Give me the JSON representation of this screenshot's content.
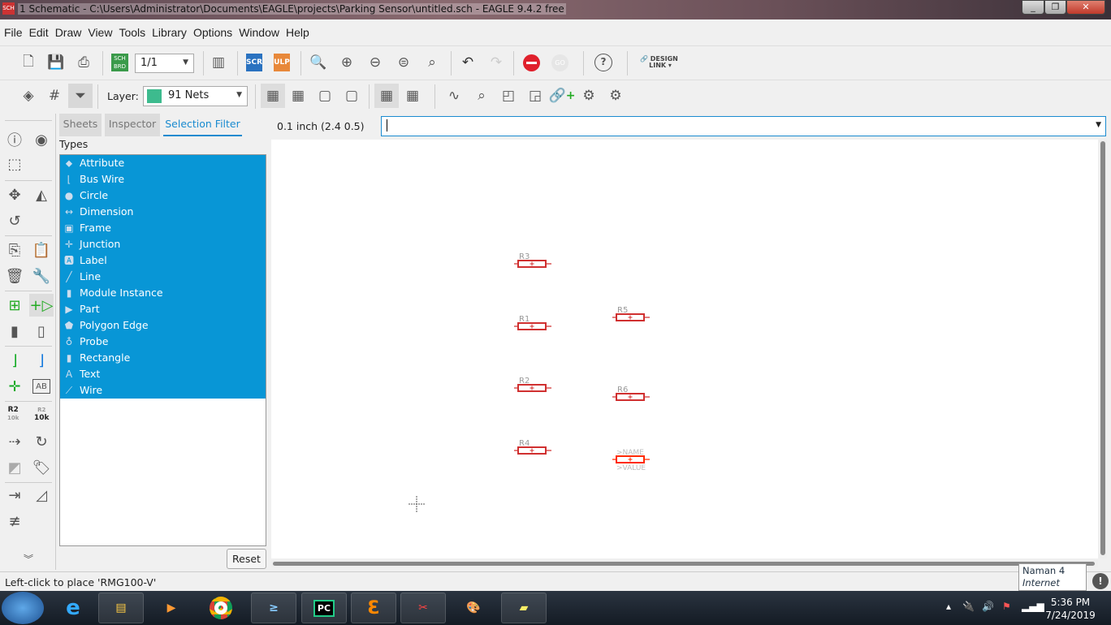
{
  "window": {
    "title": "1 Schematic - C:\\Users\\Administrator\\Documents\\EAGLE\\projects\\Parking Sensor\\untitled.sch - EAGLE 9.4.2 free",
    "app_icon_label": "SCH",
    "controls": [
      "minimize",
      "maximize",
      "close"
    ]
  },
  "menu": [
    "File",
    "Edit",
    "Draw",
    "View",
    "Tools",
    "Library",
    "Options",
    "Window",
    "Help"
  ],
  "toolbar1": {
    "sheet_value": "1/1",
    "sch_brd_label": [
      "SCH",
      "BRD"
    ],
    "scr_label": "SCR",
    "ulp_label": "ULP",
    "go_label": "GO",
    "help_label": "?",
    "design_link_label": [
      "DESIGN",
      "LINK"
    ]
  },
  "toolbar2": {
    "layer_label": "Layer:",
    "layer_value": "91 Nets",
    "layer_color": "#3dbb8e"
  },
  "panel": {
    "tabs": [
      "Sheets",
      "Inspector",
      "Selection Filter"
    ],
    "active_tab": "Selection Filter",
    "types_label": "Types",
    "types": [
      {
        "label": "Attribute",
        "icon": "tag-icon"
      },
      {
        "label": "Bus Wire",
        "icon": "bus-wire-icon"
      },
      {
        "label": "Circle",
        "icon": "circle-icon"
      },
      {
        "label": "Dimension",
        "icon": "dimension-icon"
      },
      {
        "label": "Frame",
        "icon": "frame-icon"
      },
      {
        "label": "Junction",
        "icon": "junction-icon"
      },
      {
        "label": "Label",
        "icon": "label-icon"
      },
      {
        "label": "Line",
        "icon": "line-icon"
      },
      {
        "label": "Module Instance",
        "icon": "module-icon"
      },
      {
        "label": "Part",
        "icon": "part-icon"
      },
      {
        "label": "Polygon Edge",
        "icon": "polygon-icon"
      },
      {
        "label": "Probe",
        "icon": "probe-icon"
      },
      {
        "label": "Rectangle",
        "icon": "rectangle-icon"
      },
      {
        "label": "Text",
        "icon": "text-icon"
      },
      {
        "label": "Wire",
        "icon": "wire-icon"
      }
    ],
    "reset_label": "Reset",
    "selection_color": "#0896d6"
  },
  "left_tools": {
    "r2_label": "R2",
    "r2_value": "10k"
  },
  "command_bar": {
    "coordinate": "0.1 inch (2.4 0.5)",
    "command_value": ""
  },
  "canvas": {
    "parts": [
      "R3",
      "R1",
      "R5",
      "R2",
      "R6",
      "R4"
    ],
    "placing": {
      "name": ">NAME",
      "value": ">VALUE"
    },
    "part_color": "#d03030",
    "placing_color": "#ff2a00"
  },
  "status": {
    "message": "Left-click to place 'RMG100-V'"
  },
  "network_tooltip": {
    "name": "Naman  4",
    "status": "Internet access"
  },
  "taskbar": {
    "apps": [
      "internet-explorer",
      "file-explorer",
      "media-player",
      "chrome",
      "powershell",
      "pycharm",
      "eagle",
      "snipping-tool",
      "paint",
      "sticky-notes"
    ],
    "pycharm_label": "PC",
    "time": "5:36 PM",
    "date": "7/24/2019"
  }
}
